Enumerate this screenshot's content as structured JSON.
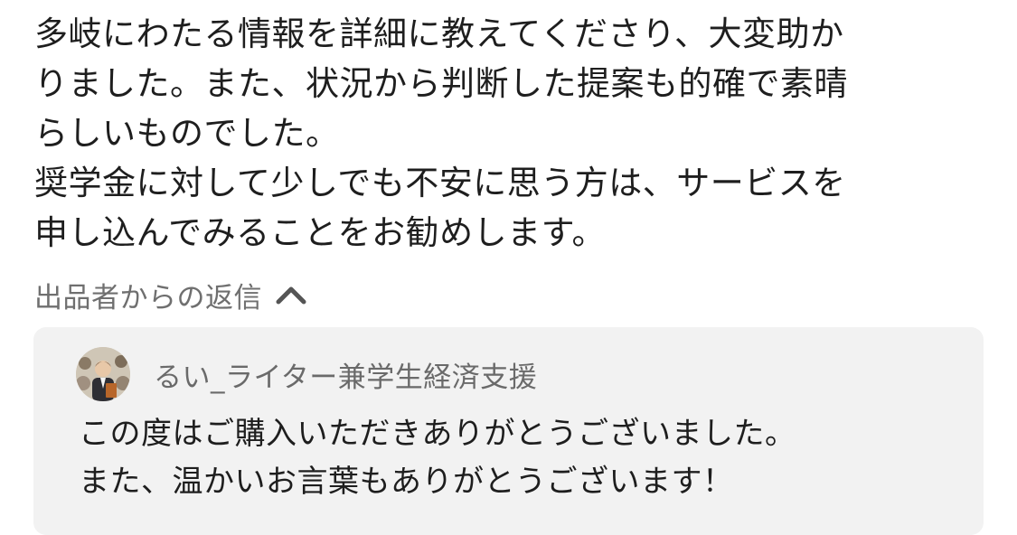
{
  "review": {
    "lines": [
      "多岐にわたる情報を詳細に教えてくださり、大変助か",
      "りました。また、状況から判断した提案も的確で素晴",
      "らしいものでした。",
      "奨学金に対して少しでも不安に思う方は、サービスを",
      "申し込んでみることをお勧めします。"
    ]
  },
  "reply_toggle": {
    "label": "出品者からの返信",
    "icon": "chevron-up-icon"
  },
  "seller_reply": {
    "seller_name": "るい_ライター兼学生経済支援",
    "avatar_icon": "seller-avatar",
    "lines": [
      "この度はご購入いただきありがとうございました。",
      "また、温かいお言葉もありがとうございます！"
    ]
  },
  "colors": {
    "body_text": "#1e1e1e",
    "muted_text": "#6f6f6f",
    "reply_background": "#f2f2f2"
  }
}
